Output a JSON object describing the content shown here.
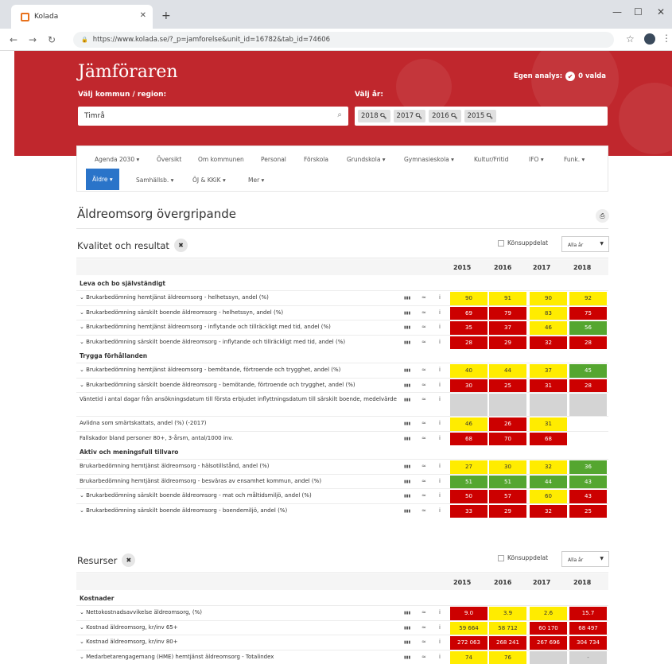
{
  "browser": {
    "tab_title": "Kolada",
    "url": "https://www.kolada.se/?_p=jamforelse&unit_id=16782&tab_id=74606"
  },
  "header": {
    "brand": "Jämföraren",
    "kommun_label": "Välj kommun / region:",
    "kommun_value": "Timrå",
    "year_label": "Välj år:",
    "years": [
      "2018",
      "2017",
      "2016",
      "2015"
    ],
    "egen_label": "Egen analys:",
    "valda": "0 valda"
  },
  "nav": {
    "items": [
      "Agenda 2030 ▾",
      "Översikt",
      "Om kommunen",
      "Personal",
      "Förskola",
      "Grundskola ▾",
      "Gymnasieskola ▾",
      "Kultur/Fritid",
      "IFO ▾",
      "Funk. ▾"
    ],
    "items2": [
      "Äldre ▾",
      "Samhällsb. ▾",
      "ÖJ & KKiK ▾",
      "Mer ▾"
    ]
  },
  "page_title": "Äldreomsorg övergripande",
  "sections": [
    {
      "title": "Kvalitet och resultat",
      "gender": "Könsuppdelat",
      "alla_ar": "Alla år",
      "years": [
        "2015",
        "2016",
        "2017",
        "2018"
      ],
      "groups": [
        {
          "name": "Leva och bo självständigt",
          "rows": [
            {
              "label": "⌄ Brukarbedömning hemtjänst äldreomsorg - helhetssyn, andel (%)",
              "values": [
                "90",
                "91",
                "90",
                "92"
              ],
              "colors": [
                "y",
                "y",
                "y",
                "y"
              ]
            },
            {
              "label": "⌄ Brukarbedömning särskilt boende äldreomsorg - helhetssyn, andel (%)",
              "values": [
                "69",
                "79",
                "83",
                "75"
              ],
              "colors": [
                "r",
                "r",
                "y",
                "r"
              ]
            },
            {
              "label": "⌄ Brukarbedömning hemtjänst äldreomsorg - inflytande och tillräckligt med tid, andel (%)",
              "values": [
                "35",
                "37",
                "46",
                "56"
              ],
              "colors": [
                "r",
                "r",
                "y",
                "g"
              ]
            },
            {
              "label": "⌄ Brukarbedömning särskilt boende äldreomsorg - inflytande och tillräckligt med tid, andel (%)",
              "values": [
                "28",
                "29",
                "32",
                "28"
              ],
              "colors": [
                "r",
                "r",
                "r",
                "r"
              ]
            }
          ]
        },
        {
          "name": "Trygga förhållanden",
          "rows": [
            {
              "label": "⌄ Brukarbedömning hemtjänst äldreomsorg - bemötande, förtroende och trygghet, andel (%)",
              "values": [
                "40",
                "44",
                "37",
                "45"
              ],
              "colors": [
                "y",
                "y",
                "y",
                "g"
              ]
            },
            {
              "label": "⌄ Brukarbedömning särskilt boende äldreomsorg - bemötande, förtroende och trygghet, andel (%)",
              "values": [
                "30",
                "25",
                "31",
                "28"
              ],
              "colors": [
                "r",
                "r",
                "r",
                "r"
              ]
            },
            {
              "label": "Väntetid i antal dagar från ansökningsdatum till första erbjudet inflyttningsdatum till särskilt boende, medelvärde",
              "values": [
                "",
                "",
                "",
                ""
              ],
              "colors": [
                "n",
                "n",
                "n",
                "n"
              ],
              "tall": true
            },
            {
              "label": "Avlidna som smärtskattats, andel (%) (-2017)",
              "values": [
                "46",
                "26",
                "31",
                ""
              ],
              "colors": [
                "y",
                "r",
                "y",
                "none"
              ]
            },
            {
              "label": "Fallskador bland personer 80+, 3-årsm, antal/1000 inv.",
              "values": [
                "68",
                "70",
                "68",
                ""
              ],
              "colors": [
                "r",
                "r",
                "r",
                "none"
              ]
            }
          ]
        },
        {
          "name": "Aktiv och meningsfull tillvaro",
          "rows": [
            {
              "label": "Brukarbedömning hemtjänst äldreomsorg - hälsotillstånd, andel (%)",
              "values": [
                "27",
                "30",
                "32",
                "36"
              ],
              "colors": [
                "y",
                "y",
                "y",
                "g"
              ]
            },
            {
              "label": "Brukarbedömning hemtjänst äldreomsorg - besväras av ensamhet kommun, andel (%)",
              "values": [
                "51",
                "51",
                "44",
                "43"
              ],
              "colors": [
                "g",
                "g",
                "g",
                "g"
              ]
            },
            {
              "label": "⌄ Brukarbedömning särskilt boende äldreomsorg - mat och måltidsmiljö, andel (%)",
              "values": [
                "50",
                "57",
                "60",
                "43"
              ],
              "colors": [
                "r",
                "r",
                "y",
                "r"
              ]
            },
            {
              "label": "⌄ Brukarbedömning särskilt boende äldreomsorg - boendemiljö, andel (%)",
              "values": [
                "33",
                "29",
                "32",
                "25"
              ],
              "colors": [
                "r",
                "r",
                "r",
                "r"
              ]
            }
          ]
        }
      ]
    },
    {
      "title": "Resurser",
      "gender": "Könsuppdelat",
      "alla_ar": "Alla år",
      "years": [
        "2015",
        "2016",
        "2017",
        "2018"
      ],
      "groups": [
        {
          "name": "Kostnader",
          "rows": [
            {
              "label": "⌄ Nettokostnadsavvikelse äldreomsorg, (%)",
              "values": [
                "9.0",
                "3.9",
                "2.6",
                "15.7"
              ],
              "colors": [
                "r",
                "y",
                "y",
                "r"
              ]
            },
            {
              "label": "⌄ Kostnad äldreomsorg, kr/inv 65+",
              "values": [
                "59 664",
                "58 712",
                "60 170",
                "68 497"
              ],
              "colors": [
                "y",
                "y",
                "r",
                "r"
              ]
            },
            {
              "label": "⌄ Kostnad äldreomsorg, kr/inv 80+",
              "values": [
                "272 063",
                "268 241",
                "267 696",
                "304 734"
              ],
              "colors": [
                "r",
                "r",
                "r",
                "r"
              ]
            },
            {
              "label": "⌄ Medarbetarengagemang (HME) hemtjänst äldreomsorg - Totalindex",
              "values": [
                "74",
                "76",
                "",
                "-"
              ],
              "colors": [
                "y",
                "y",
                "n",
                "n"
              ]
            }
          ]
        }
      ]
    }
  ],
  "colors": {
    "yellow": "#ffec00",
    "red": "#cc0000",
    "green": "#55a630",
    "grey": "#d4d4d4",
    "header_red": "#c0272d",
    "nav_blue": "#2a74c9"
  }
}
